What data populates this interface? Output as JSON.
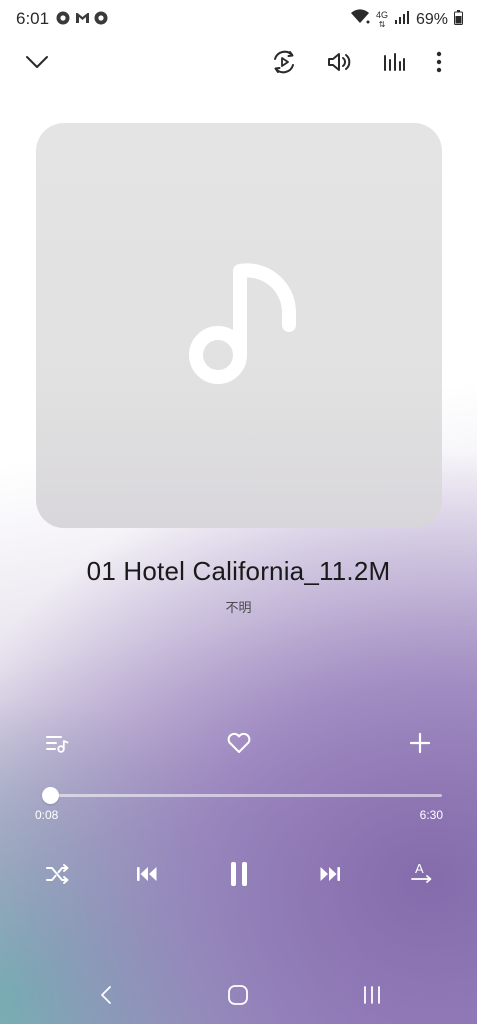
{
  "status_bar": {
    "time": "6:01",
    "network": "4G",
    "battery": "69%",
    "notification_icons": [
      "chrome-icon",
      "gmail-icon",
      "chrome-icon"
    ]
  },
  "toolbar": {
    "icons": [
      "collapse-chevron-icon",
      "cast-icon",
      "volume-icon",
      "equalizer-icon",
      "more-options-icon"
    ]
  },
  "track": {
    "title": "01 Hotel California_11.2M",
    "artist": "不明"
  },
  "playback": {
    "current_time": "0:08",
    "total_time": "6:30",
    "progress": 0.02,
    "state": "playing"
  },
  "actions": {
    "icons": [
      "playlist-icon",
      "favorite-heart-icon",
      "add-icon"
    ]
  },
  "controls": {
    "icons": [
      "shuffle-icon",
      "previous-icon",
      "pause-icon",
      "next-icon",
      "repeat-icon"
    ]
  },
  "nav_bar": {
    "icons": [
      "back-icon",
      "home-icon",
      "recents-icon"
    ]
  },
  "colors": {
    "accent_purple": "#8a76b3",
    "accent_teal": "#7fb8b0",
    "album_bg": "#e2e2e2"
  }
}
